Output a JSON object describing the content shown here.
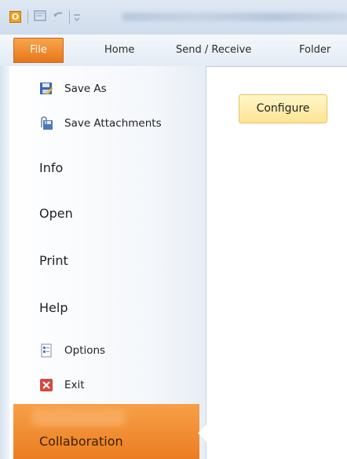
{
  "qat": {
    "app_icon_letter": "O"
  },
  "tabs": {
    "file": "File",
    "home": "Home",
    "send_receive": "Send / Receive",
    "folder": "Folder"
  },
  "backstage": {
    "commands": [
      {
        "label": "Save As",
        "icon": "save-as-icon"
      },
      {
        "label": "Save Attachments",
        "icon": "save-attachments-icon"
      }
    ],
    "nav": [
      "Info",
      "Open",
      "Print",
      "Help"
    ],
    "bottom_commands": [
      {
        "label": "Options",
        "icon": "options-icon"
      },
      {
        "label": "Exit",
        "icon": "exit-icon"
      }
    ],
    "selected": "Collaboration"
  },
  "content": {
    "configure_label": "Configure"
  },
  "colors": {
    "file_tab": "#e8761a",
    "selected_item": "#ec7d22",
    "configure_button": "#fde492"
  }
}
